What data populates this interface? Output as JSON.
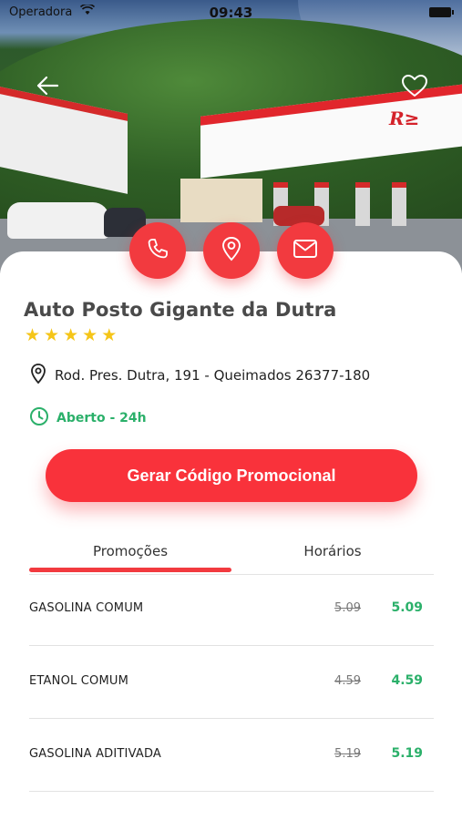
{
  "status_bar": {
    "carrier": "Operadora",
    "time": "09:43"
  },
  "station": {
    "name": "Auto Posto Gigante da Dutra",
    "rating": 5,
    "address": "Rod. Pres. Dutra, 191 - Queimados 26377-180",
    "hours": "Aberto - 24h"
  },
  "icons": {
    "back": "arrow-left-icon",
    "favorite": "heart-icon",
    "phone": "phone-icon",
    "location": "map-pin-icon",
    "email": "mail-icon",
    "clock": "clock-icon",
    "star": "star-icon"
  },
  "promo_button": "Gerar Código Promocional",
  "tabs": [
    {
      "label": "Promoções",
      "active": true
    },
    {
      "label": "Horários",
      "active": false
    }
  ],
  "prices": [
    {
      "name": "GASOLINA COMUM",
      "old": "5.09",
      "new": "5.09"
    },
    {
      "name": "ETANOL COMUM",
      "old": "4.59",
      "new": "4.59"
    },
    {
      "name": "GASOLINA ADITIVADA",
      "old": "5.19",
      "new": "5.19"
    }
  ],
  "colors": {
    "accent": "#f23a3f",
    "green": "#2bb06a",
    "star": "#f5c518"
  }
}
